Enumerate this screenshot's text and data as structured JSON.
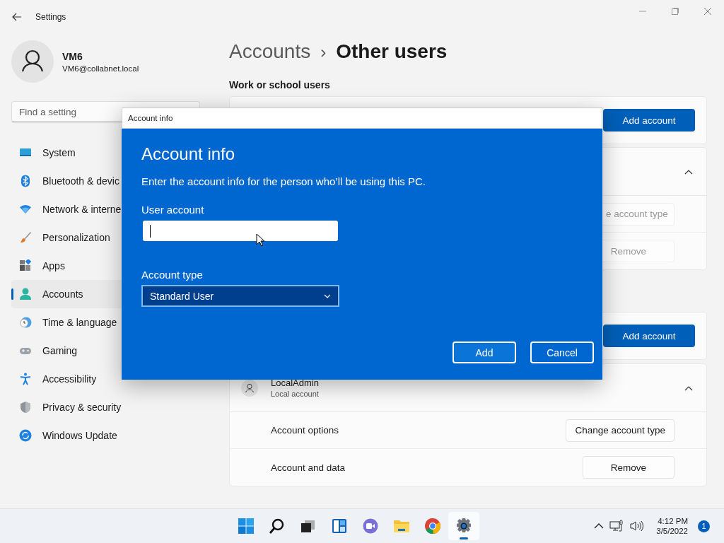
{
  "window": {
    "title": "Settings"
  },
  "profile": {
    "name": "VM6",
    "email": "VM6@collabnet.local"
  },
  "search": {
    "placeholder": "Find a setting"
  },
  "nav": [
    {
      "label": "System",
      "selected": false
    },
    {
      "label": "Bluetooth & devic",
      "selected": false
    },
    {
      "label": "Network & interne",
      "selected": false
    },
    {
      "label": "Personalization",
      "selected": false
    },
    {
      "label": "Apps",
      "selected": false
    },
    {
      "label": "Accounts",
      "selected": true
    },
    {
      "label": "Time & language",
      "selected": false
    },
    {
      "label": "Gaming",
      "selected": false
    },
    {
      "label": "Accessibility",
      "selected": false
    },
    {
      "label": "Privacy & security",
      "selected": false
    },
    {
      "label": "Windows Update",
      "selected": false
    }
  ],
  "breadcrumb": {
    "parent": "Accounts",
    "separator": "›",
    "current": "Other users"
  },
  "work_or_school": {
    "heading": "Work or school users",
    "add_button": "Add account",
    "account": {
      "expanded": true,
      "buttons": [
        {
          "label": "e account type",
          "disabled": true
        },
        {
          "label": "Remove",
          "disabled": true
        }
      ]
    }
  },
  "other_users": {
    "add_button": "Add account",
    "account": {
      "name": "LocalAdmin",
      "subtitle": "Local account",
      "expanded": true,
      "rows": [
        {
          "label": "Account options",
          "button": {
            "label": "Change account type",
            "disabled": false
          }
        },
        {
          "label": "Account and data",
          "button": {
            "label": "Remove",
            "disabled": false
          }
        }
      ]
    }
  },
  "dialog": {
    "title": "Account info",
    "heading": "Account info",
    "description": "Enter the account info for the person who’ll be using this PC.",
    "user_account": {
      "label": "User account",
      "focused": true
    },
    "account_type": {
      "label": "Account type",
      "value": "Standard User"
    },
    "buttons": [
      "Add",
      "Cancel"
    ]
  },
  "taskbar": {
    "apps": [
      {
        "selected": false
      },
      {
        "selected": false
      },
      {
        "selected": false
      },
      {
        "selected": false
      },
      {
        "selected": false
      },
      {
        "selected": false
      },
      {
        "selected": false
      },
      {
        "selected": true
      }
    ],
    "time": "4:12 PM",
    "date": "3/5/2022",
    "notifications": "1"
  }
}
